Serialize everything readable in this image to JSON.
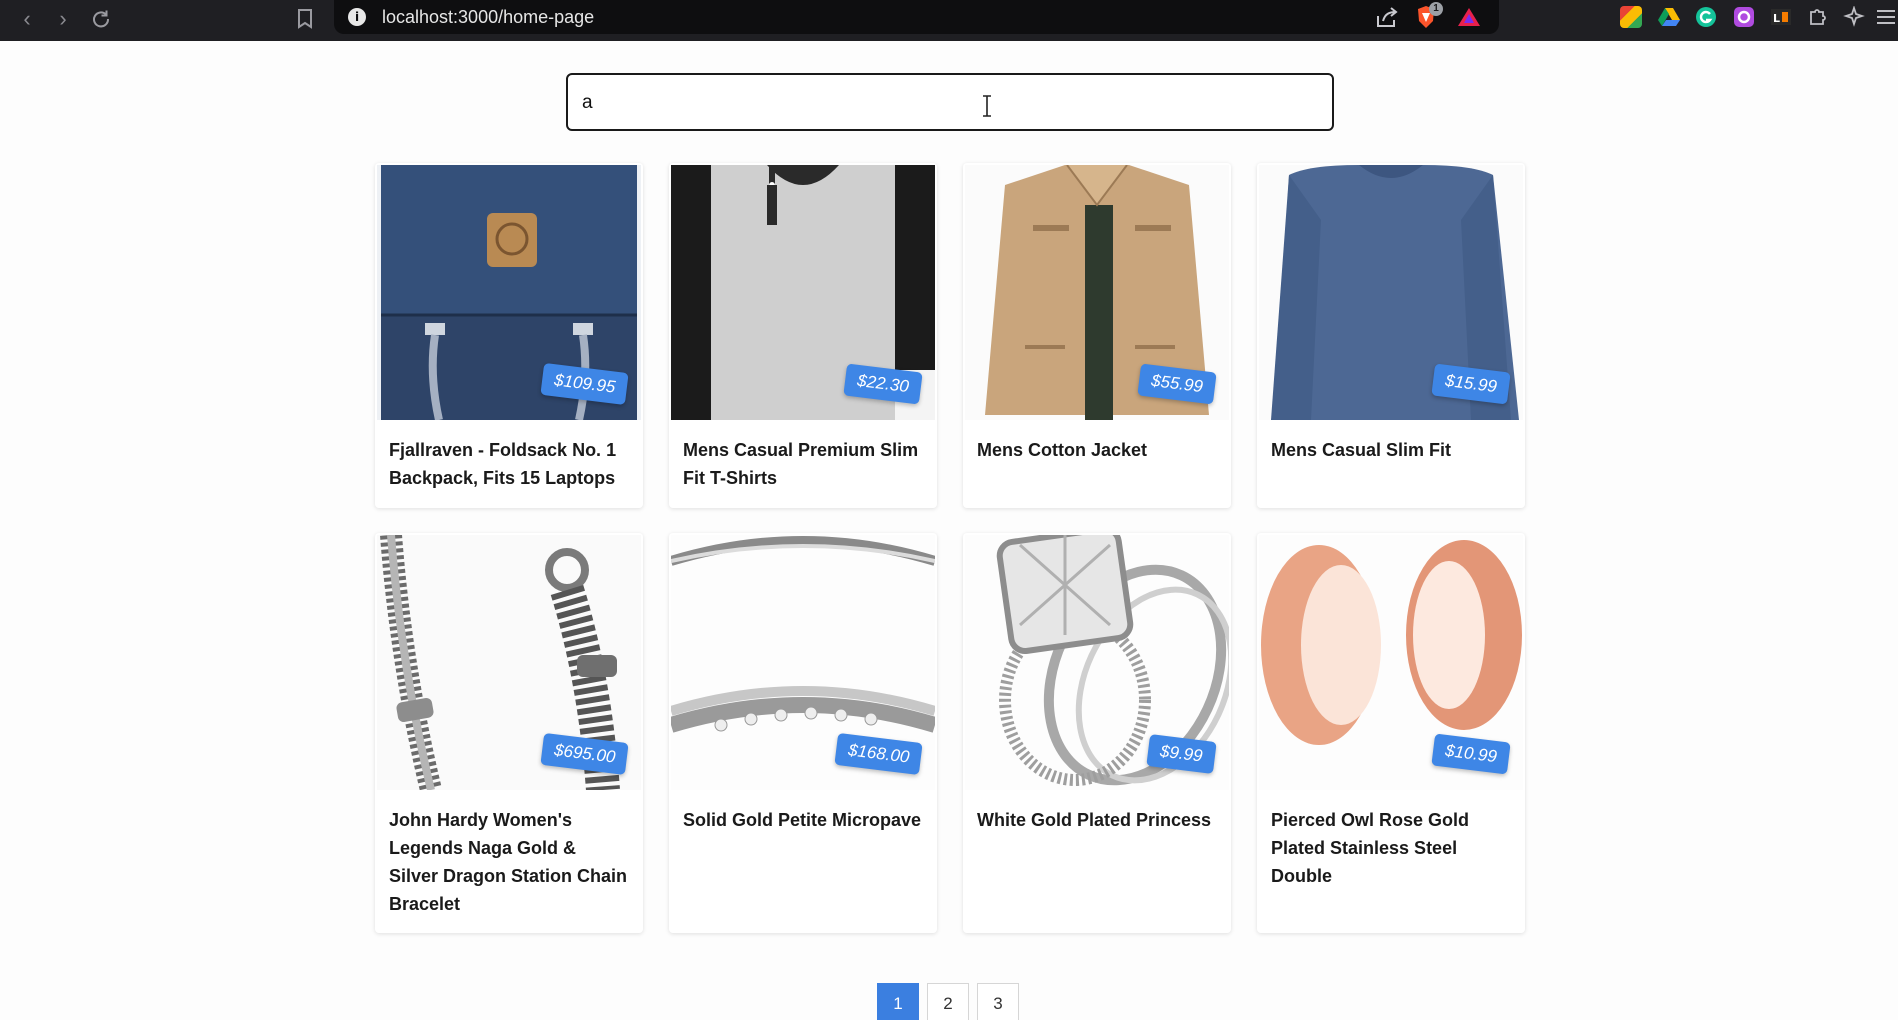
{
  "browser": {
    "url": "localhost:3000/home-page",
    "shield_badge": "1"
  },
  "search": {
    "value": "a"
  },
  "products": [
    {
      "title": "Fjallraven - Foldsack No. 1 Backpack, Fits 15 Laptops",
      "price": "$109.95"
    },
    {
      "title": "Mens Casual Premium Slim Fit T-Shirts",
      "price": "$22.30"
    },
    {
      "title": "Mens Cotton Jacket",
      "price": "$55.99"
    },
    {
      "title": "Mens Casual Slim Fit",
      "price": "$15.99"
    },
    {
      "title": "John Hardy Women's Legends Naga Gold & Silver Dragon Station Chain Bracelet",
      "price": "$695.00"
    },
    {
      "title": "Solid Gold Petite Micropave",
      "price": "$168.00"
    },
    {
      "title": "White Gold Plated Princess",
      "price": "$9.99"
    },
    {
      "title": "Pierced Owl Rose Gold Plated Stainless Steel Double",
      "price": "$10.99"
    }
  ],
  "pagination": {
    "pages": [
      "1",
      "2",
      "3"
    ],
    "current": "1"
  },
  "colors": {
    "accent": "#3b7fe0",
    "price_tag": "#3e86e6"
  }
}
